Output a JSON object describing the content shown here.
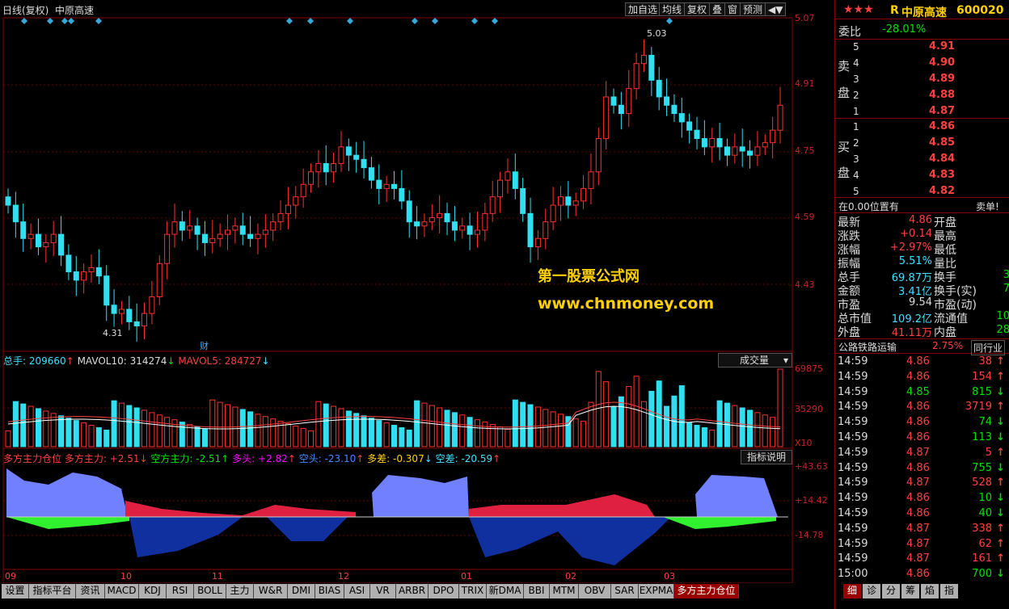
{
  "toolbar": {
    "title": "日线(复权)",
    "stock": "中原高速",
    "btn1": "加自选",
    "btn2": "均线",
    "btn3": "复权",
    "btn4": "叠",
    "btn5": "窗",
    "btn6": "预测",
    "btn7": "◀▼"
  },
  "price_axis": [
    "5.07",
    "4.91",
    "4.75",
    "4.59",
    "4.43"
  ],
  "annot": {
    "high": "5.03",
    "low": "4.31",
    "cai": "财"
  },
  "watermark": {
    "line1": "第一股票公式网",
    "line2": "www.chnmoney.com"
  },
  "vol": {
    "zongshou": "总手: 209660",
    "mavol10": "MAVOL10: 314274",
    "mavol5": "MAVOL5: 284727",
    "dropdown": "成交量",
    "axis": [
      "69875",
      "35290",
      "X10"
    ]
  },
  "ind": {
    "name": "多方主力仓位",
    "duofang": "多方主力: +2.51",
    "kongfang": "空方主力: -2.51",
    "duotou": "多头: +2.82",
    "kongtou": "空头: -23.10",
    "duocha": "多差: -0.307",
    "kongcha": "空差: -20.59",
    "btn": "指标说明",
    "axis": [
      "+43.63",
      "+14.42",
      "-14.78"
    ]
  },
  "xaxis": [
    "09",
    "10",
    "11",
    "12",
    "01",
    "02",
    "03"
  ],
  "tabs": [
    "设置",
    "指标平台",
    "资讯",
    "MACD",
    "KDJ",
    "RSI",
    "BOLL",
    "主力",
    "W&R",
    "DMI",
    "BIAS",
    "ASI",
    "VR",
    "ARBR",
    "DPO",
    "TRIX",
    "新DMA",
    "BBI",
    "MTM",
    "OBV",
    "SAR",
    "EXPMA",
    "多方主力仓位"
  ],
  "right": {
    "stars": "★★★",
    "r": "R",
    "name": "中原高速",
    "code": "600020",
    "weibi_label": "委比",
    "weibi": "-28.01%",
    "sell_label": [
      "卖",
      "盘"
    ],
    "buy_label": [
      "买",
      "盘"
    ],
    "sells": [
      [
        "5",
        "4.91"
      ],
      [
        "4",
        "4.90"
      ],
      [
        "3",
        "4.89"
      ],
      [
        "2",
        "4.88"
      ],
      [
        "1",
        "4.87"
      ]
    ],
    "buys": [
      [
        "1",
        "4.86"
      ],
      [
        "2",
        "4.85"
      ],
      [
        "3",
        "4.84"
      ],
      [
        "4",
        "4.83"
      ],
      [
        "5",
        "4.82"
      ]
    ],
    "pos_text": "在0.00位置有",
    "pos_right": "卖单!",
    "stats": [
      [
        "最新",
        "4.86",
        "red",
        "开盘",
        ""
      ],
      [
        "涨跌",
        "+0.14",
        "red",
        "最高",
        ""
      ],
      [
        "涨幅",
        "+2.97%",
        "red",
        "最低",
        ""
      ],
      [
        "振幅",
        "5.51%",
        "cyan",
        "量比",
        ""
      ],
      [
        "总手",
        "69.87万",
        "cyan",
        "换手",
        "3"
      ],
      [
        "金额",
        "3.41亿",
        "cyan",
        "换手(实)",
        "7"
      ],
      [
        "市盈",
        "9.54",
        "white",
        "市盈(动)",
        ""
      ],
      [
        "总市值",
        "109.2亿",
        "cyan",
        "流通值",
        "10"
      ],
      [
        "外盘",
        "41.11万",
        "red",
        "内盘",
        "28"
      ]
    ],
    "sector": "公路铁路运输",
    "sector_pct": "2.75%",
    "sector_btn": "同行业",
    "ticks": [
      [
        "14:59",
        "4.86",
        "38",
        "up"
      ],
      [
        "14:59",
        "4.86",
        "154",
        "up"
      ],
      [
        "14:59",
        "4.85",
        "815",
        "down"
      ],
      [
        "14:59",
        "4.86",
        "3719",
        "up"
      ],
      [
        "14:59",
        "4.86",
        "74",
        "down"
      ],
      [
        "14:59",
        "4.86",
        "113",
        "down"
      ],
      [
        "14:59",
        "4.87",
        "5",
        "up"
      ],
      [
        "14:59",
        "4.86",
        "755",
        "down"
      ],
      [
        "14:59",
        "4.87",
        "528",
        "up"
      ],
      [
        "14:59",
        "4.86",
        "10",
        "down"
      ],
      [
        "14:59",
        "4.86",
        "40",
        "down"
      ],
      [
        "14:59",
        "4.87",
        "338",
        "up"
      ],
      [
        "14:59",
        "4.87",
        "62",
        "up"
      ],
      [
        "14:59",
        "4.87",
        "161",
        "up"
      ],
      [
        "15:00",
        "4.86",
        "700",
        "down"
      ]
    ],
    "btabs": [
      "细",
      "诊",
      "分",
      "筹",
      "焰",
      "指"
    ]
  }
}
